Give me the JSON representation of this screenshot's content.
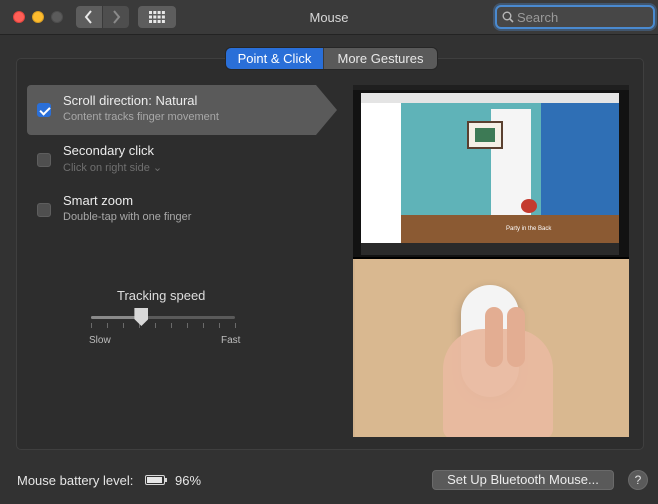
{
  "window": {
    "title": "Mouse"
  },
  "search": {
    "placeholder": "Search"
  },
  "tabs": [
    {
      "label": "Point & Click",
      "active": true
    },
    {
      "label": "More Gestures",
      "active": false
    }
  ],
  "options": [
    {
      "title": "Scroll direction: Natural",
      "subtitle": "Content tracks finger movement",
      "checked": true,
      "selected": true
    },
    {
      "title": "Secondary click",
      "subtitle": "Click on right side ⌄",
      "checked": false,
      "selected": false,
      "subtitle_dim": true
    },
    {
      "title": "Smart zoom",
      "subtitle": "Double-tap with one finger",
      "checked": false,
      "selected": false
    }
  ],
  "tracking": {
    "label": "Tracking speed",
    "min_label": "Slow",
    "max_label": "Fast",
    "value_fraction": 0.35,
    "ticks": 10
  },
  "preview": {
    "caption": "Party in the Back"
  },
  "footer": {
    "battery_label": "Mouse battery level:",
    "battery_percent": "96%",
    "battery_fraction": 0.96,
    "bt_button": "Set Up Bluetooth Mouse...",
    "help": "?"
  },
  "colors": {
    "accent": "#2a6fd8",
    "background": "#323232"
  }
}
